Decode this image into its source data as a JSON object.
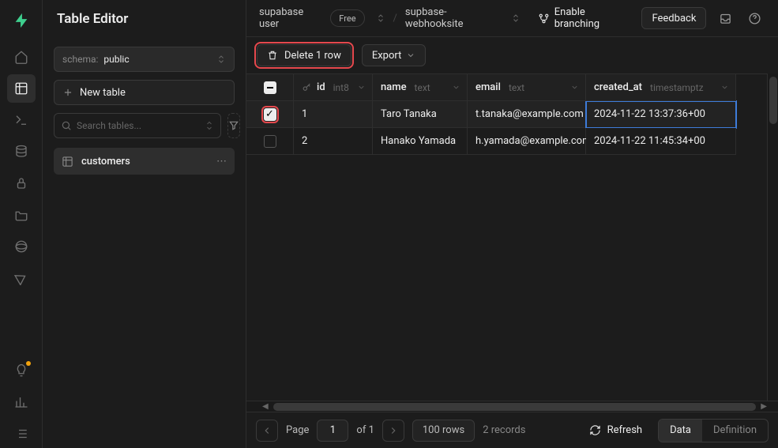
{
  "header": {
    "title": "Table Editor"
  },
  "topbar": {
    "user": "supabase user",
    "plan": "Free",
    "project": "supbase-webhooksite",
    "branching": "Enable branching",
    "feedback": "Feedback"
  },
  "sidebar": {
    "schema_label": "schema:",
    "schema_value": "public",
    "new_table": "New table",
    "search_placeholder": "Search tables...",
    "tables": [
      {
        "name": "customers"
      }
    ]
  },
  "toolbar": {
    "delete_label": "Delete 1 row",
    "export_label": "Export"
  },
  "columns": [
    {
      "name": "id",
      "type": "int8",
      "pk": true
    },
    {
      "name": "name",
      "type": "text",
      "pk": false
    },
    {
      "name": "email",
      "type": "text",
      "pk": false
    },
    {
      "name": "created_at",
      "type": "timestamptz",
      "pk": false
    }
  ],
  "rows": [
    {
      "selected": true,
      "id": "1",
      "name": "Taro Tanaka",
      "email": "t.tanaka@example.com",
      "created_at": "2024-11-22 13:37:36+00"
    },
    {
      "selected": false,
      "id": "2",
      "name": "Hanako Yamada",
      "email": "h.yamada@example.com",
      "created_at": "2024-11-22 11:45:34+00"
    }
  ],
  "footer": {
    "page_label": "Page",
    "page_value": "1",
    "of_label": "of 1",
    "rows_label": "100 rows",
    "records_label": "2 records",
    "refresh": "Refresh",
    "data": "Data",
    "definition": "Definition"
  }
}
